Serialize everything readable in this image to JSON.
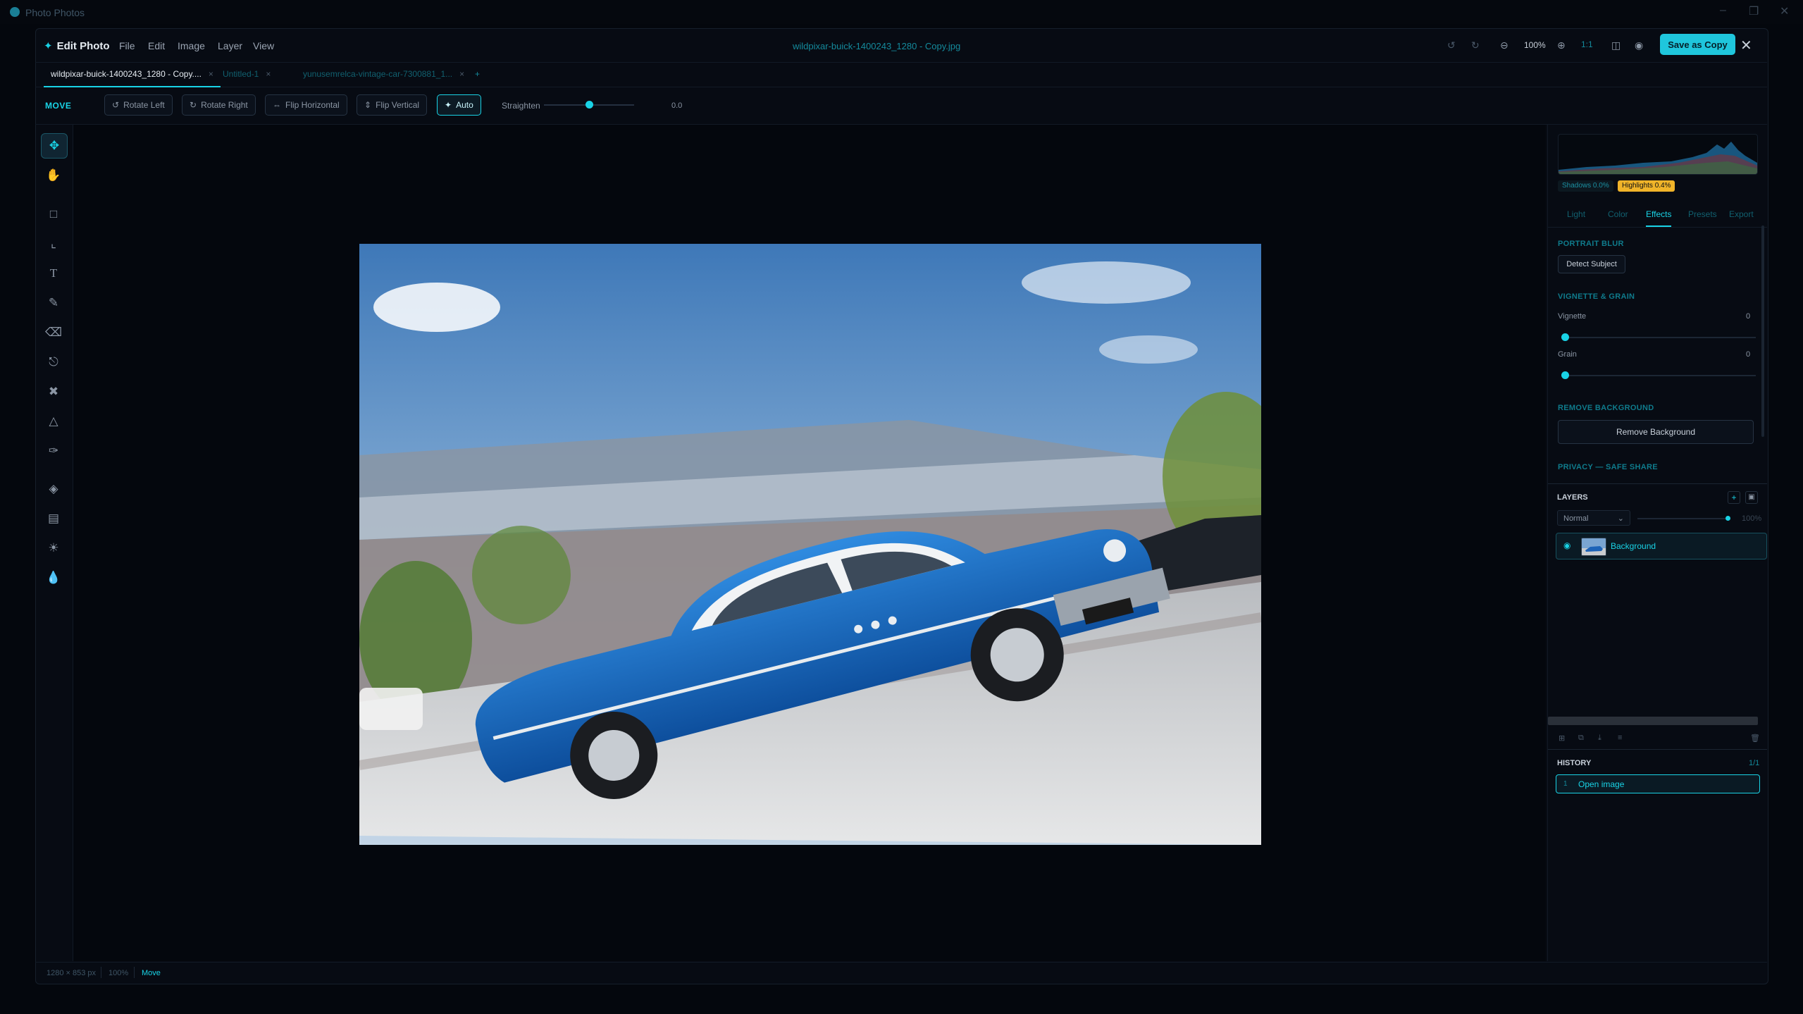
{
  "window": {
    "app_title": "Photo Photos"
  },
  "menubar": {
    "brand": "Edit Photo",
    "items": [
      "File",
      "Edit",
      "Image",
      "Layer",
      "View"
    ],
    "document_title": "wildpixar-buick-1400243_1280 - Copy.jpg",
    "zoom": "100%",
    "one_to_one": "1:1",
    "save_label": "Save as Copy"
  },
  "tabs": {
    "items": [
      {
        "label": "wildpixar-buick-1400243_1280 - Copy...."
      },
      {
        "label": "Untitled-1"
      },
      {
        "label": "yunusemrelca-vintage-car-7300881_1..."
      }
    ],
    "add": "+"
  },
  "toolbar": {
    "mode": "MOVE",
    "rotate_left": "Rotate Left",
    "rotate_right": "Rotate Right",
    "flip_horizontal": "Flip Horizontal",
    "flip_vertical": "Flip Vertical",
    "auto": "Auto",
    "straighten_label": "Straighten",
    "straighten_value": "0.0",
    "straighten_fraction": 0.5
  },
  "panel": {
    "shadows": "Shadows 0.0%",
    "highlights": "Highlights 0.4%",
    "tabs": [
      "Light",
      "Color",
      "Effects",
      "Presets",
      "Export"
    ],
    "active_tab": "Effects",
    "portrait_blur": {
      "title": "PORTRAIT BLUR",
      "button": "Detect Subject"
    },
    "vignette_grain": {
      "title": "VIGNETTE & GRAIN",
      "vignette_label": "Vignette",
      "vignette_value": "0",
      "grain_label": "Grain",
      "grain_value": "0"
    },
    "remove_background": {
      "title": "REMOVE BACKGROUND",
      "button": "Remove Background"
    },
    "privacy": {
      "title": "PRIVACY — SAFE SHARE"
    }
  },
  "layers": {
    "title": "LAYERS",
    "blend_mode": "Normal",
    "opacity": "100%",
    "items": [
      {
        "name": "Background"
      }
    ]
  },
  "history": {
    "title": "HISTORY",
    "count": "1/1",
    "items": [
      {
        "index": "1",
        "label": "Open image"
      }
    ]
  },
  "status": {
    "dimensions": "1280 × 853 px",
    "zoom": "100%",
    "tool": "Move"
  },
  "colors": {
    "accent": "#19d3e6",
    "highlight_badge": "#f0b429",
    "background": "#04070d"
  }
}
